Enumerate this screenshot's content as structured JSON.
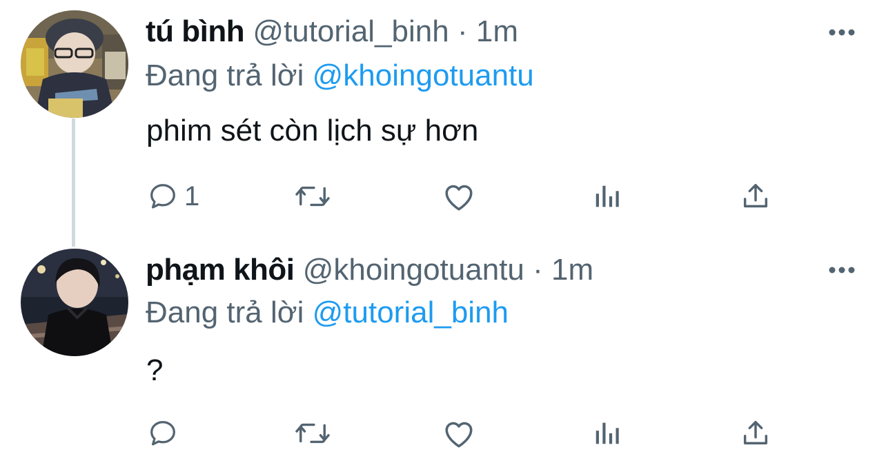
{
  "replying_prefix": "Đang trả lời",
  "tweets": [
    {
      "display_name": "tú bình",
      "handle": "@tutorial_binh",
      "separator": "·",
      "time": "1m",
      "replying_to": "@khoingotuantu",
      "text": "phim sét còn lịch sự hơn",
      "reply_count": "1",
      "avatar": "avatar-photo-person-with-glasses-and-beanie"
    },
    {
      "display_name": "phạm khôi",
      "handle": "@khoingotuantu",
      "separator": "·",
      "time": "1m",
      "replying_to": "@tutorial_binh",
      "text": "?",
      "reply_count": "",
      "avatar": "avatar-photo-person-in-leather-jacket-night"
    }
  ],
  "icons": [
    "reply-icon",
    "retweet-icon",
    "like-icon",
    "views-icon",
    "share-icon",
    "more-icon"
  ],
  "colors": {
    "text_primary": "#0f1419",
    "text_secondary": "#536471",
    "link": "#1d9bf0",
    "thread_line": "#cfd9de"
  }
}
